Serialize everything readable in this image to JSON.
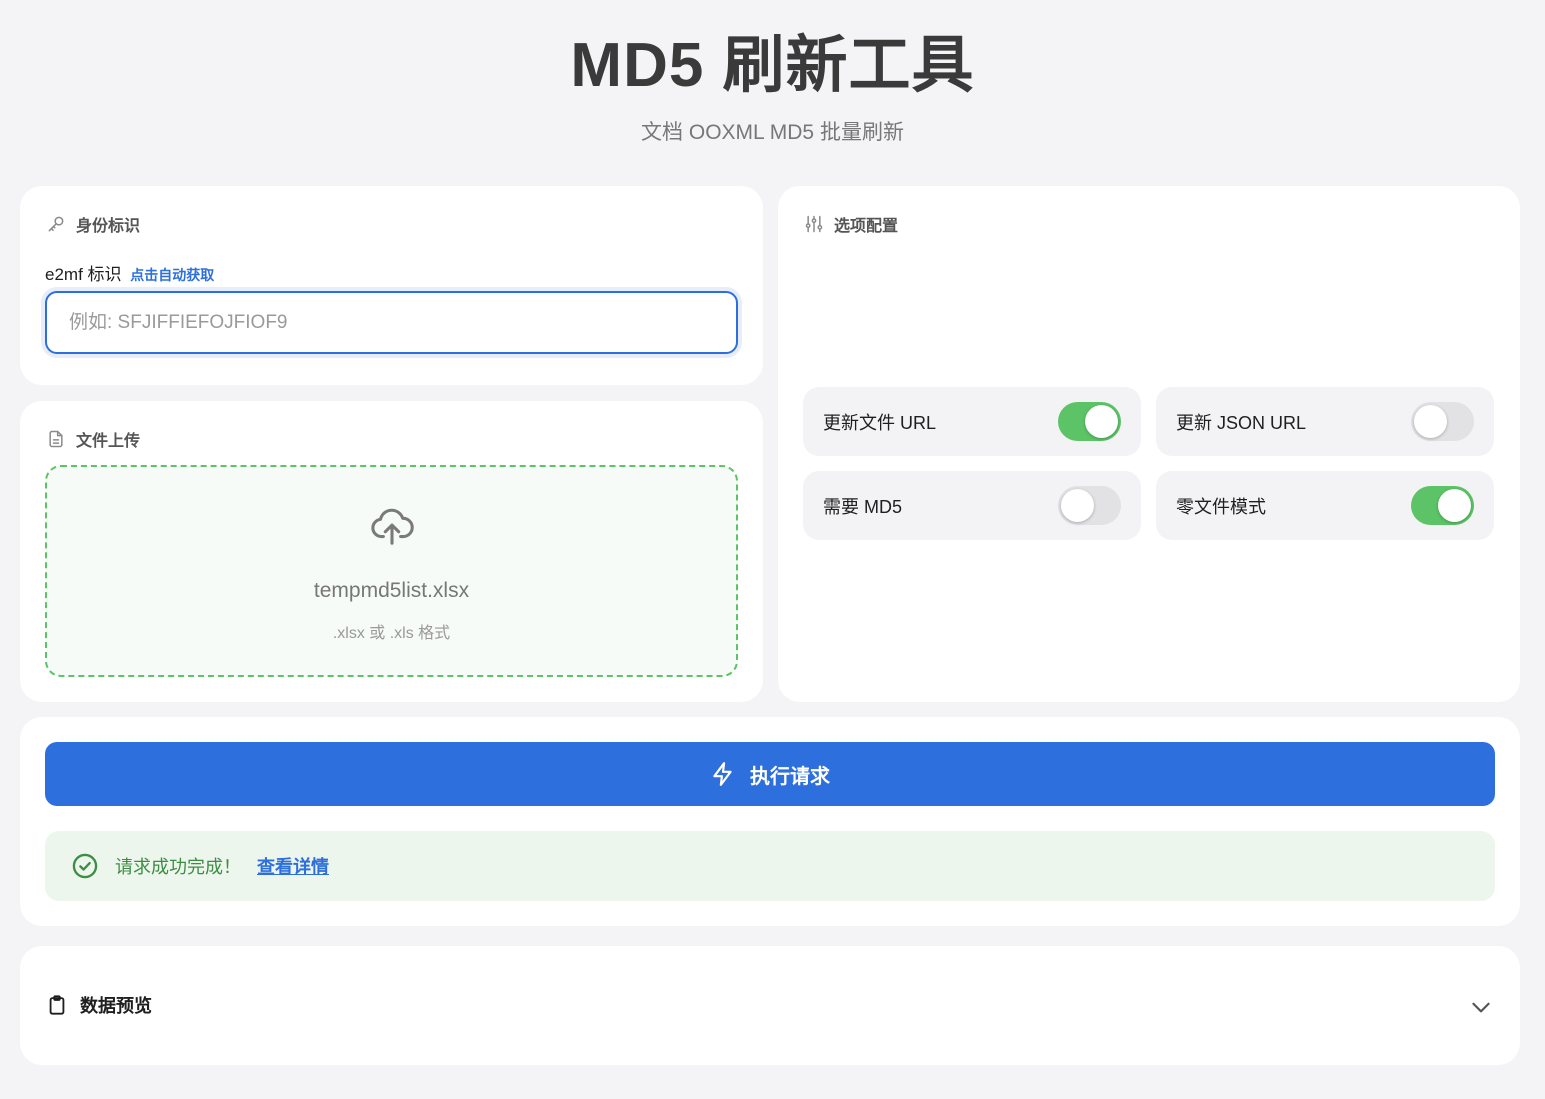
{
  "header": {
    "title": "MD5 刷新工具",
    "subtitle": "文档 OOXML MD5 批量刷新"
  },
  "identity": {
    "section_title": "身份标识",
    "icon": "key-icon",
    "field_label": "e2mf 标识",
    "auto_fetch_link": "点击自动获取",
    "input_value": "",
    "input_placeholder": "例如: SFJIFFIEFOJFIOF9"
  },
  "upload": {
    "section_title": "文件上传",
    "icon": "document-icon",
    "file_name": "tempmd5list.xlsx",
    "hint": ".xlsx 或 .xls 格式",
    "dropzone_icon": "cloud-upload-icon"
  },
  "options": {
    "section_title": "选项配置",
    "icon": "sliders-icon",
    "toggles": [
      {
        "label": "更新文件 URL",
        "on": true
      },
      {
        "label": "更新 JSON URL",
        "on": false
      },
      {
        "label": "需要 MD5",
        "on": false
      },
      {
        "label": "零文件模式",
        "on": true
      }
    ]
  },
  "action": {
    "execute_label": "执行请求",
    "execute_icon": "lightning-icon",
    "success_text": "请求成功完成！",
    "success_link": "查看详情",
    "success_icon": "check-circle-icon"
  },
  "preview": {
    "title": "数据预览",
    "icon": "clipboard-icon",
    "expanded": false
  },
  "colors": {
    "accent": "#2e6fde",
    "success": "#5cc466",
    "success_text": "#3e8d44",
    "background": "#f4f4f6"
  }
}
